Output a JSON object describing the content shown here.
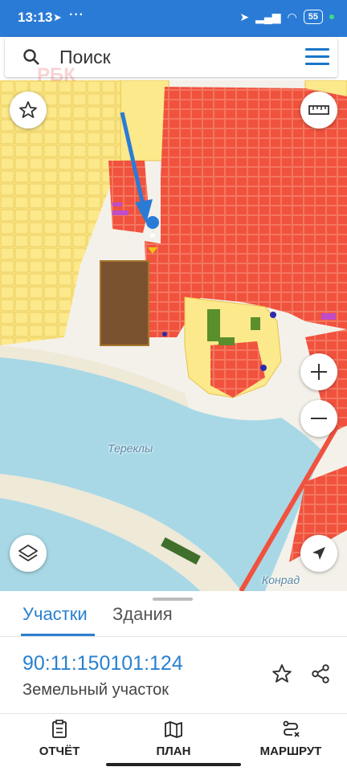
{
  "status": {
    "time": "13:13",
    "more": "···",
    "battery": "55"
  },
  "search": {
    "placeholder": "Поиск",
    "watermark": "РБК"
  },
  "map": {
    "labels": {
      "lake": "Тереклы",
      "road": "Конрад"
    }
  },
  "tabs": [
    {
      "label": "Участки",
      "active": true
    },
    {
      "label": "Здания",
      "active": false
    }
  ],
  "parcel": {
    "id": "90:11:150101:124",
    "type": "Земельный участок"
  },
  "nav": [
    {
      "label": "ОТЧЁТ",
      "icon": "report-icon"
    },
    {
      "label": "ПЛАН",
      "icon": "map-icon"
    },
    {
      "label": "МАРШРУТ",
      "icon": "route-icon"
    }
  ],
  "colors": {
    "accent": "#2a80cf",
    "statusbar": "#2a7bd6",
    "parcel_red": "#f0523e",
    "parcel_yellow": "#fbe98b",
    "water": "#a8d8e6"
  }
}
